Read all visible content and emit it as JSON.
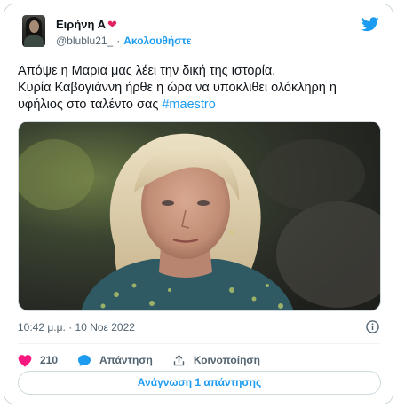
{
  "author": {
    "display_name": "Ειρήνη Α",
    "handle": "@blublu21_",
    "separator": "·",
    "follow_label": "Ακολουθήστε"
  },
  "tweet": {
    "line1": "Απόψε η Μαρια μας λέει την δική της ιστορία.",
    "line2": "Κυρία Καβογιάννη ήρθε η ώρα να υποκλιθει ολόκληρη η",
    "line3_text": "υφήλιος στο ταλέντο σας ",
    "hashtag": "#maestro"
  },
  "meta": {
    "timestamp": "10:42 μ.μ. · 10 Νοε 2022"
  },
  "actions": {
    "likes_count": "210",
    "reply_label": "Απάντηση",
    "share_label": "Κοινοποίηση"
  },
  "read_replies_label": "Ανάγνωση 1 απάντησης",
  "colors": {
    "accent": "#1d9bf0",
    "like": "#f91880",
    "text": "#0f1419",
    "muted": "#536471",
    "border": "#cfd9de"
  },
  "icons": [
    "heart-icon",
    "twitter-bird-icon",
    "info-icon",
    "like-heart-icon",
    "reply-bubble-icon",
    "share-icon"
  ]
}
